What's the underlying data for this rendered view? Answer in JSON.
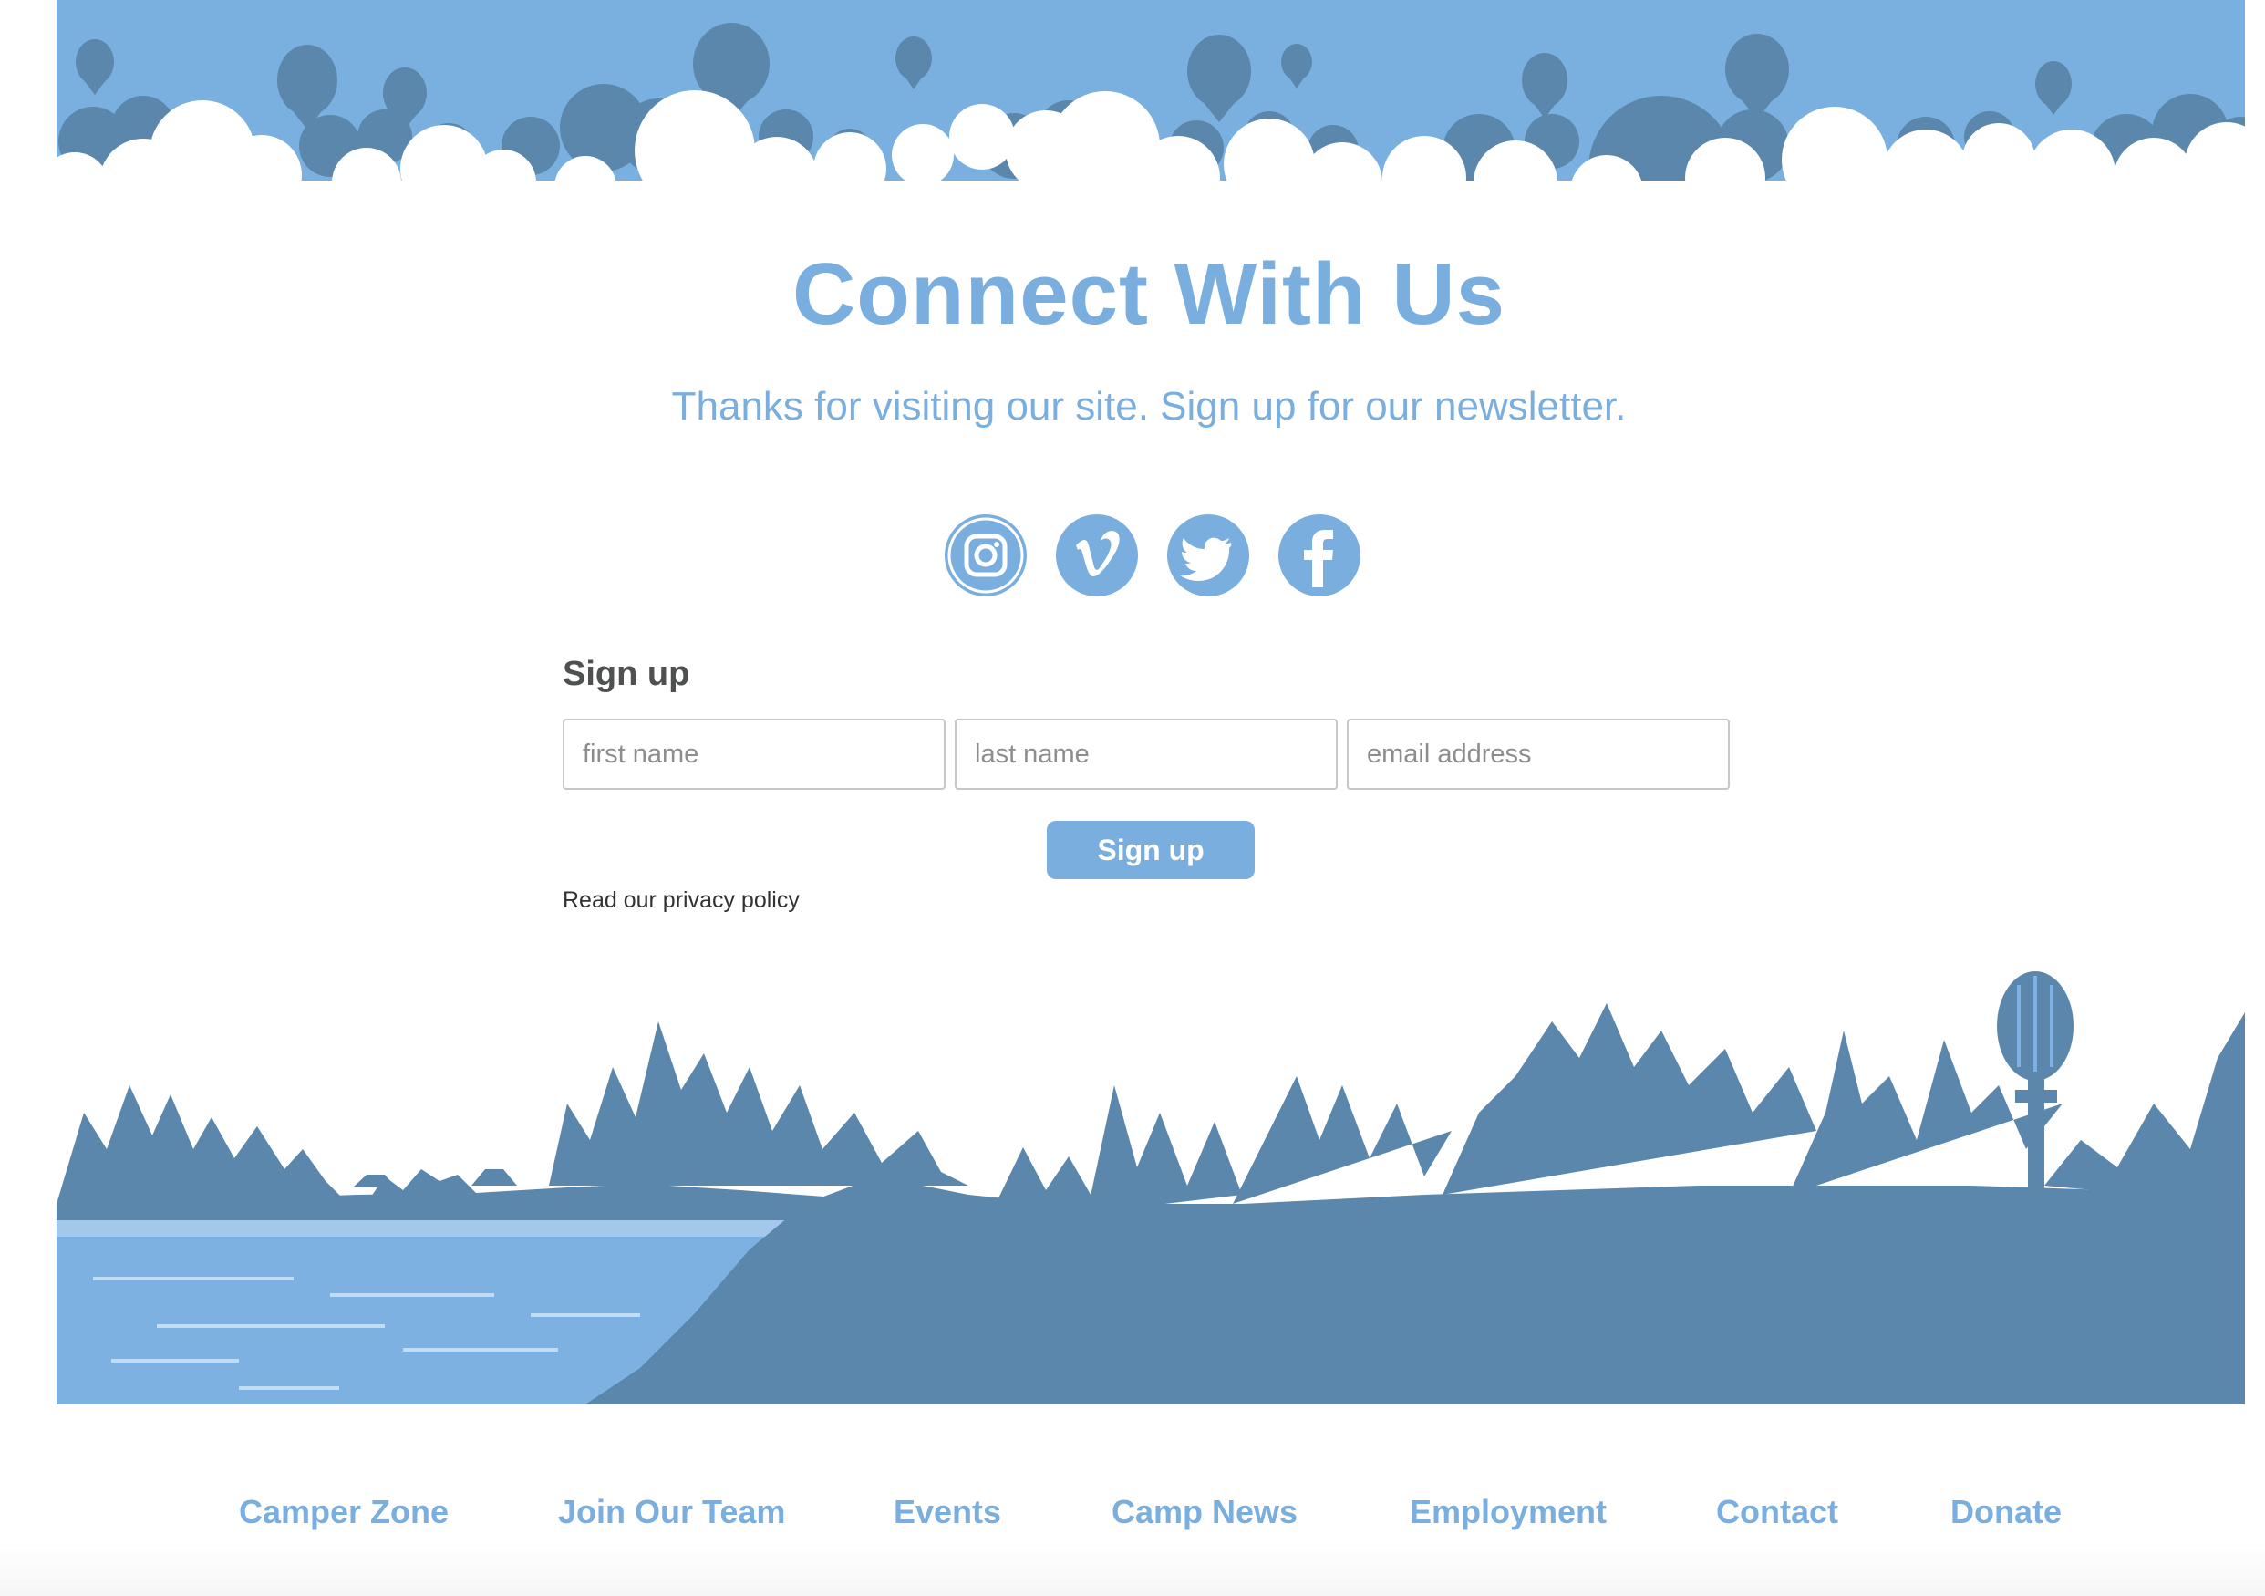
{
  "colors": {
    "accent": "#79aede",
    "sky": "#7ab0e0",
    "silhouette": "#5a87ab",
    "water": "#7db1e1",
    "heading_dark": "#4f5151"
  },
  "header": {
    "title": "Connect With Us",
    "subtitle": "Thanks for visiting our site. Sign up for our newsletter."
  },
  "social": [
    {
      "name": "instagram",
      "icon": "instagram-icon"
    },
    {
      "name": "vimeo",
      "icon": "vimeo-icon"
    },
    {
      "name": "twitter",
      "icon": "twitter-icon"
    },
    {
      "name": "facebook",
      "icon": "facebook-icon"
    }
  ],
  "signup_form": {
    "heading": "Sign up",
    "first_name_placeholder": "first name",
    "last_name_placeholder": "last name",
    "email_placeholder": "email address",
    "first_name_value": "",
    "last_name_value": "",
    "email_value": "",
    "submit_label": "Sign up",
    "privacy_link": "Read our privacy policy"
  },
  "footer_nav": [
    {
      "label": "Camper Zone"
    },
    {
      "label": "Join Our Team"
    },
    {
      "label": "Events"
    },
    {
      "label": "Camp News"
    },
    {
      "label": "Employment"
    },
    {
      "label": "Contact"
    },
    {
      "label": "Donate"
    }
  ]
}
